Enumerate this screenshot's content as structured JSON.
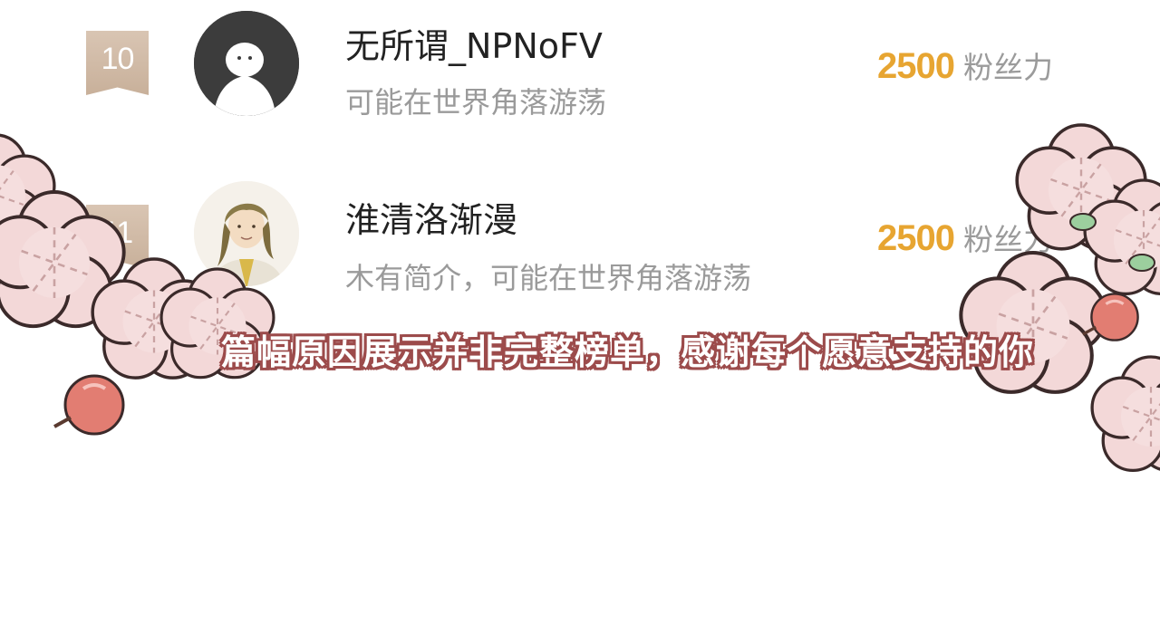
{
  "ranking": [
    {
      "rank": "10",
      "name": "无所谓_NPNoFV",
      "bio": "可能在世界角落游荡",
      "score": "2500",
      "score_unit": "粉丝力",
      "avatar_icon": "default-ghost-avatar-icon"
    },
    {
      "rank": "11",
      "name": "淮清洛渐漫",
      "bio": "木有简介，可能在世界角落游荡",
      "score": "2500",
      "score_unit": "粉丝力",
      "avatar_icon": "anime-character-avatar-icon"
    }
  ],
  "caption": "篇幅原因展示并非完整榜单，感谢每个愿意支持的你",
  "colors": {
    "score": "#e7a531",
    "rank_badge": "#c8b09a",
    "caption_outline": "#9c4b4b",
    "blossom": "#f2d6d6"
  }
}
